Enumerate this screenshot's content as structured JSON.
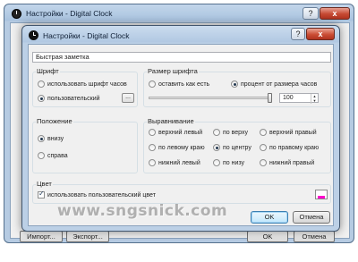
{
  "back_window": {
    "title": "Настройки - Digital Clock",
    "help": "?",
    "close": "x",
    "buttons": {
      "import": "Импорт...",
      "export": "Экспорт...",
      "ok": "OK",
      "cancel": "Отмена"
    }
  },
  "dialog": {
    "title": "Настройки - Digital Clock",
    "help": "?",
    "close": "x",
    "text_field": {
      "value": "Быстрая заметка"
    },
    "font_group": {
      "label": "Шрифт",
      "options": [
        "использовать шрифт часов",
        "пользовательский"
      ],
      "selected": "пользовательский",
      "browse_label": "..."
    },
    "size_group": {
      "label": "Размер шрифта",
      "options": [
        "оставить как есть",
        "процент от размера часов"
      ],
      "selected": "процент от размера часов",
      "value": "100",
      "slider_level_percent": 100
    },
    "position_group": {
      "label": "Положение",
      "options": [
        "внизу",
        "справа"
      ],
      "selected": "внизу"
    },
    "align_group": {
      "label": "Выравнивание",
      "options": [
        "верхний левый",
        "по верху",
        "верхний правый",
        "по левому краю",
        "по центру",
        "по правому краю",
        "нижний левый",
        "по низу",
        "нижний правый"
      ],
      "selected": "по центру"
    },
    "color_group": {
      "label": "Цвет",
      "checkbox_label": "использовать пользовательский цвет",
      "checked": true,
      "swatch_color": "#ff00cc"
    },
    "ok_label": "OK",
    "cancel_label": "Отмена"
  },
  "watermark": "www.sngsnick.com",
  "icons": [
    "clock-icon",
    "help-icon",
    "close-icon"
  ]
}
